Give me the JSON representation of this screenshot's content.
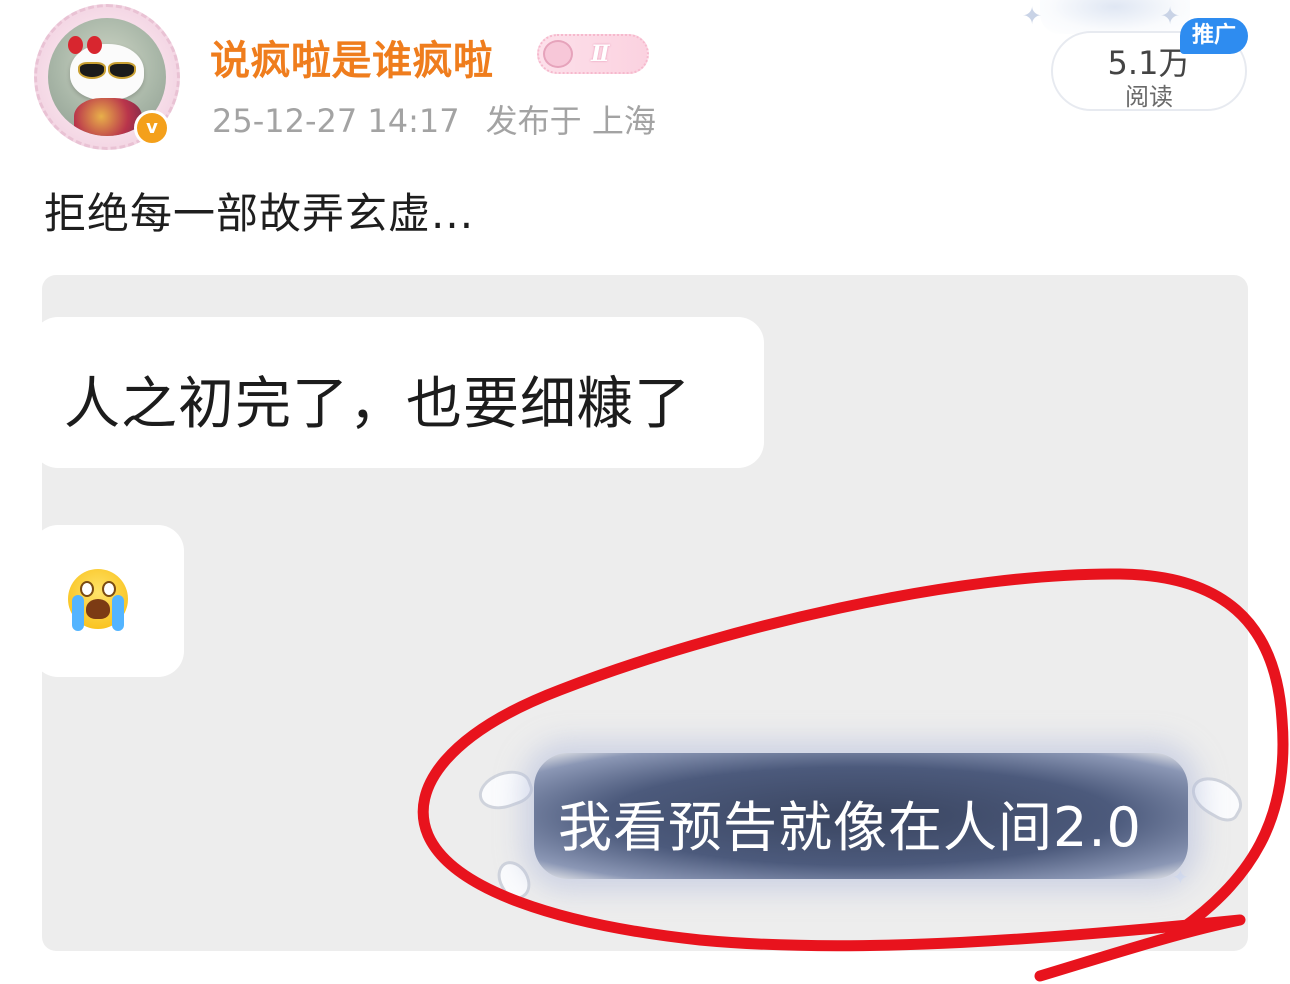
{
  "post": {
    "author": {
      "name": "说疯啦是谁疯啦",
      "verified_mark": "v",
      "decoration_text": "Ⅱ",
      "avatar": "hello-kitty-sunglasses-avatar"
    },
    "timestamp": "25-12-27 14:17",
    "location": "发布于 上海",
    "text": "拒绝每一部故弄玄虚...",
    "stats": {
      "reads_count": "5.1万",
      "reads_label": "阅读",
      "promo_label": "推广"
    },
    "image": {
      "message_1": "人之初完了，也要细糠了",
      "message_2_emoji": "crying-face-emoji",
      "message_3": "我看预告就像在人间2.0"
    }
  },
  "colors": {
    "username": "#ef7d1d",
    "meta": "#a3a3a3",
    "verified_badge": "#f4a01b",
    "promo_badge": "#2e8cf0",
    "annotation": "#e8131d",
    "card_background": "#ededed"
  }
}
